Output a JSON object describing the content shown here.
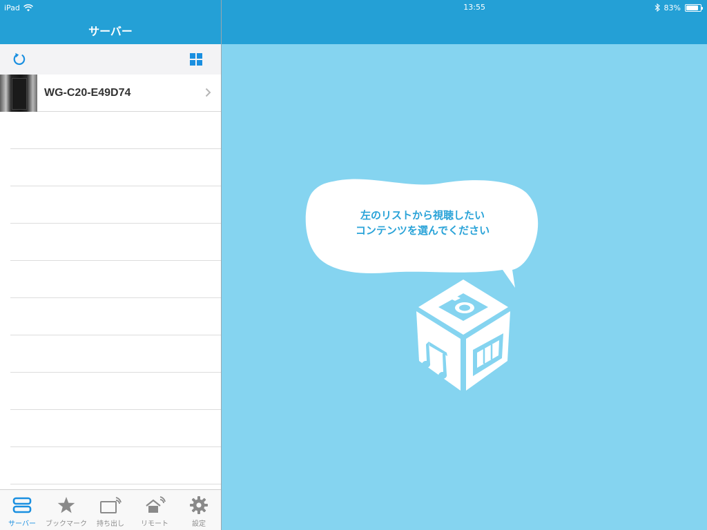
{
  "status_bar": {
    "device": "iPad",
    "time": "13:55",
    "battery_text": "83%",
    "battery_level": 0.83
  },
  "left_panel": {
    "title": "サーバー",
    "servers": [
      {
        "name": "WG-C20-E49D74"
      }
    ]
  },
  "tabbar": {
    "tabs": [
      {
        "label": "サーバー",
        "icon": "server-icon",
        "active": true
      },
      {
        "label": "ブックマーク",
        "icon": "star-icon",
        "active": false
      },
      {
        "label": "持ち出し",
        "icon": "takeout-icon",
        "active": false
      },
      {
        "label": "リモート",
        "icon": "remote-icon",
        "active": false
      },
      {
        "label": "設定",
        "icon": "gear-icon",
        "active": false
      }
    ]
  },
  "detail": {
    "message_line1": "左のリストから視聴したい",
    "message_line2": "コンテンツを選んでください"
  },
  "colors": {
    "header": "#24a0d6",
    "detail_background": "#85d4f0",
    "accent": "#1a8fe0",
    "bubble_text": "#2aa3d8"
  }
}
